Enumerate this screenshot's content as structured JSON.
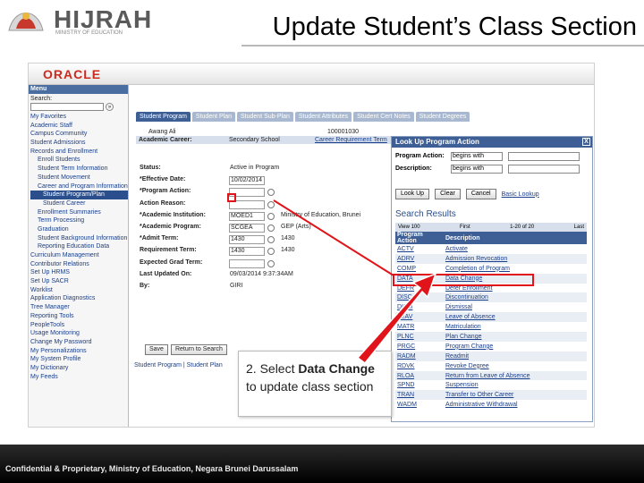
{
  "slide": {
    "logo": "HIJRAH",
    "logo_sub": "MINISTRY OF EDUCATION",
    "title": "Update Student’s Class Section",
    "footer": "Confidential & Proprietary, Ministry of Education, Negara Brunei Darussalam"
  },
  "app": {
    "brand": "ORACLE"
  },
  "menu": {
    "title": "Menu",
    "search_label": "Search:",
    "items": [
      {
        "label": "My Favorites",
        "level": 0
      },
      {
        "label": "Academic Staff",
        "level": 0
      },
      {
        "label": "Campus Community",
        "level": 0
      },
      {
        "label": "Student Admissions",
        "level": 0
      },
      {
        "label": "Records and Enrollment",
        "level": 0
      },
      {
        "label": "Enroll Students",
        "level": 1
      },
      {
        "label": "Student Term Information",
        "level": 1
      },
      {
        "label": "Student Movement",
        "level": 1
      },
      {
        "label": "Career and Program Information",
        "level": 1
      },
      {
        "label": "Student Program/Plan",
        "level": 2,
        "selected": true
      },
      {
        "label": "Student Career",
        "level": 2
      },
      {
        "label": "Enrollment Summaries",
        "level": 1
      },
      {
        "label": "Term Processing",
        "level": 1
      },
      {
        "label": "Graduation",
        "level": 1
      },
      {
        "label": "Student Background Information",
        "level": 1
      },
      {
        "label": "Reporting Education Data",
        "level": 1
      },
      {
        "label": "Curriculum Management",
        "level": 0
      },
      {
        "label": "Contributor Relations",
        "level": 0
      },
      {
        "label": "Set Up HRMS",
        "level": 0
      },
      {
        "label": "Set Up SACR",
        "level": 0
      },
      {
        "label": "Worklist",
        "level": 0
      },
      {
        "label": "Application Diagnostics",
        "level": 0
      },
      {
        "label": "Tree Manager",
        "level": 0
      },
      {
        "label": "Reporting Tools",
        "level": 0
      },
      {
        "label": "PeopleTools",
        "level": 0
      },
      {
        "label": "Usage Monitoring",
        "level": 0
      },
      {
        "label": "Change My Password",
        "level": 0
      },
      {
        "label": "My Personalizations",
        "level": 0
      },
      {
        "label": "My System Profile",
        "level": 0
      },
      {
        "label": "My Dictionary",
        "level": 0
      },
      {
        "label": "My Feeds",
        "level": 0
      }
    ]
  },
  "tabs": [
    "Student Program",
    "Student Plan",
    "Student Sub-Plan",
    "Student Attributes",
    "Student Cert Notes",
    "Student Degrees"
  ],
  "person": {
    "name": "Awang Ali",
    "id": "100001030"
  },
  "career": {
    "label": "Academic Career:",
    "value": "Secondary School",
    "link": "Career Requirement Term"
  },
  "form": [
    {
      "label": "Status:",
      "value": "Active in Program",
      "ro": true
    },
    {
      "label": "*Effective Date:",
      "value": "10/02/2014"
    },
    {
      "label": "*Program Action:",
      "value": ""
    },
    {
      "label": "Action Reason:",
      "value": ""
    },
    {
      "label": "*Academic Institution:",
      "value": "MOED1",
      "desc": "Ministry of Education, Brunei"
    },
    {
      "label": "*Academic Program:",
      "value": "SCGEA",
      "desc": "GEP (Arts)"
    },
    {
      "label": "*Admit Term:",
      "value": "1430",
      "desc": "1430"
    },
    {
      "label": "Requirement Term:",
      "value": "1430",
      "desc": "1430"
    },
    {
      "label": "Expected Grad Term:",
      "value": ""
    },
    {
      "label": "Last Updated On:",
      "value": "09/03/2014 9:37:34AM",
      "ro": true
    },
    {
      "label": "By:",
      "value": "GIRI",
      "ro": true
    }
  ],
  "toolbar": [
    "Save",
    "Return to Search"
  ],
  "bottom_links": "Student Program | Student Plan",
  "popup": {
    "title": "Look Up Program Action",
    "close": "X",
    "field1_label": "Program Action:",
    "field1_op": "begins with",
    "field2_label": "Description:",
    "field2_op": "begins with",
    "btn_lookup": "Look Up",
    "btn_clear": "Clear",
    "btn_cancel": "Cancel",
    "link_basic": "Basic Lookup",
    "results_title": "Search Results",
    "nav_view": "View 100",
    "nav_first": "First",
    "nav_range": "1-20 of 20",
    "nav_last": "Last",
    "col1": "Program Action",
    "col2": "Description",
    "rows": [
      [
        "ACTV",
        "Activate"
      ],
      [
        "ADRV",
        "Admission Revocation"
      ],
      [
        "COMP",
        "Completion of Program"
      ],
      [
        "DATA",
        "Data Change"
      ],
      [
        "DEFR",
        "Defer Enrollment"
      ],
      [
        "DISC",
        "Discontinuation"
      ],
      [
        "DISM",
        "Dismissal"
      ],
      [
        "LEAV",
        "Leave of Absence"
      ],
      [
        "MATR",
        "Matriculation"
      ],
      [
        "PLNC",
        "Plan Change"
      ],
      [
        "PRGC",
        "Program Change"
      ],
      [
        "RADM",
        "Readmit"
      ],
      [
        "RDVK",
        "Revoke Degree"
      ],
      [
        "RLOA",
        "Return from Leave of Absence"
      ],
      [
        "SPND",
        "Suspension"
      ],
      [
        "TRAN",
        "Transfer to Other Career"
      ],
      [
        "WADM",
        "Administrative Withdrawal"
      ]
    ]
  },
  "callout": {
    "prefix": "2. Select ",
    "em1": "Data",
    "em2": "Change",
    "suffix": " to update class section"
  },
  "colors": {
    "accent_red": "#e0141a",
    "header_blue": "#3d5f95"
  }
}
